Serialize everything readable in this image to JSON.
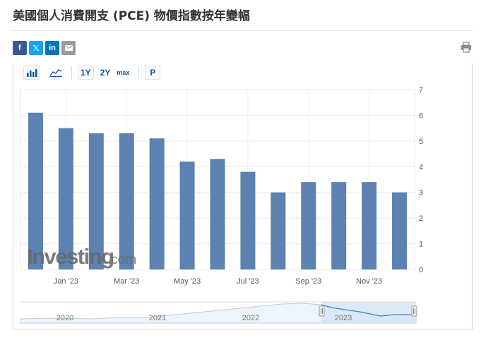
{
  "page": {
    "title": "美國個人消費開支 (PCE) 物價指數按年變幅"
  },
  "share": {
    "facebook": "f",
    "twitter": "𝕏",
    "linkedin": "in",
    "email_icon": "envelope-icon",
    "print_icon": "printer-icon"
  },
  "toolbar": {
    "bar_chart_icon": "bar-chart-icon",
    "line_chart_icon": "line-chart-icon",
    "range_1y": "1Y",
    "range_2y": "2Y",
    "range_max": "max",
    "period_p": "P"
  },
  "watermark": {
    "brand": "Investing",
    "suffix": ".com"
  },
  "navigator": {
    "years": [
      "2020",
      "2021",
      "2022",
      "2023"
    ]
  },
  "colors": {
    "bar": "#5b82b0",
    "bar_light": "#9fb8d3",
    "accent": "#1256a0",
    "navigator_fill": "#cfe2f7"
  },
  "chart_data": {
    "type": "bar",
    "categories": [
      "Dec '22",
      "Jan '23",
      "Feb '23",
      "Mar '23",
      "Apr '23",
      "May '23",
      "Jun '23",
      "Jul '23",
      "Aug '23",
      "Sep '23",
      "Oct '23",
      "Nov '23",
      "Dec '23"
    ],
    "values": [
      6.1,
      5.5,
      5.3,
      5.3,
      5.1,
      4.2,
      4.3,
      3.8,
      3.0,
      3.4,
      3.4,
      3.4,
      3.0
    ],
    "x_tick_labels": [
      "Jan '23",
      "Mar '23",
      "May '23",
      "Jul '23",
      "Sep '23",
      "Nov '23"
    ],
    "y_ticks": [
      0,
      1,
      2,
      3,
      4,
      5,
      6,
      7
    ],
    "ylim": [
      0,
      7
    ],
    "y_axis_side": "right",
    "grid": true,
    "title": "",
    "xlabel": "",
    "ylabel": ""
  }
}
